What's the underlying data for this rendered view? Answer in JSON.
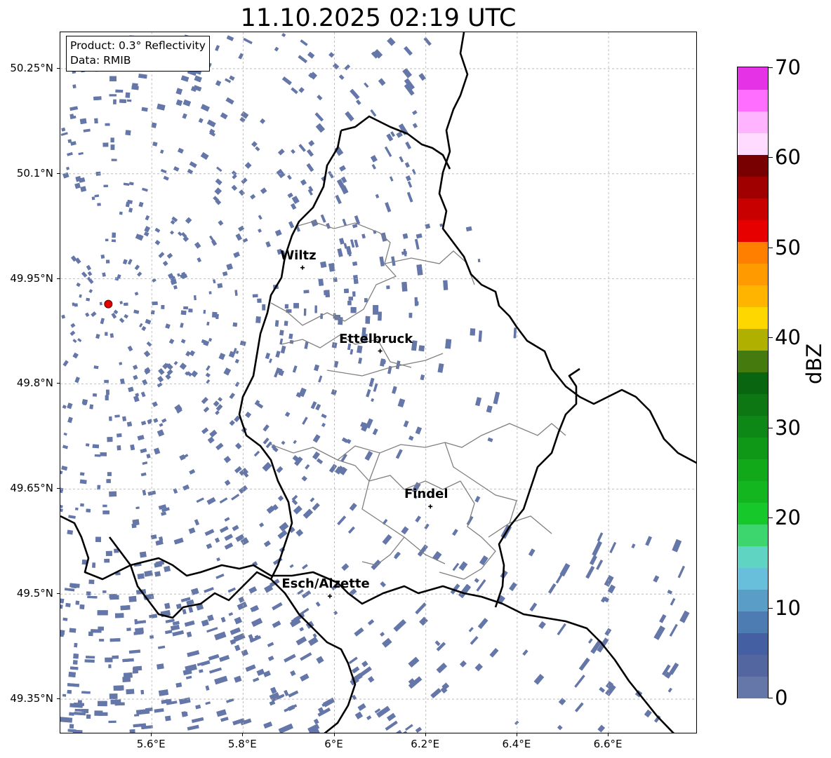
{
  "title": "11.10.2025 02:19 UTC",
  "info_box": {
    "product": "Product: 0.3° Reflectivity",
    "data_source": "Data: RMIB"
  },
  "y_ticks": [
    "50.25°N",
    "50.1°N",
    "49.95°N",
    "49.8°N",
    "49.65°N",
    "49.5°N",
    "49.35°N"
  ],
  "x_ticks": [
    "5.6°E",
    "5.8°E",
    "6°E",
    "6.2°E",
    "6.4°E",
    "6.6°E"
  ],
  "cities": [
    {
      "name": "Wiltz",
      "lon": 5.93,
      "lat": 49.966
    },
    {
      "name": "Ettelbruck",
      "lon": 6.1,
      "lat": 49.847
    },
    {
      "name": "Findel",
      "lon": 6.21,
      "lat": 49.625
    },
    {
      "name": "Esch/Alzette",
      "lon": 5.99,
      "lat": 49.497
    }
  ],
  "radar_site": {
    "lon": 5.505,
    "lat": 49.914,
    "color": "#e00000"
  },
  "map_extent": {
    "lon_min": 5.4,
    "lon_max": 6.795,
    "lat_min": 49.3,
    "lat_max": 50.302
  },
  "colorbar": {
    "label": "dBZ",
    "ticks": [
      "0",
      "10",
      "20",
      "30",
      "40",
      "50",
      "60",
      "70"
    ],
    "min": 0,
    "max": 70,
    "step": 2.5,
    "colors": [
      "#6577a8",
      "#5466a0",
      "#4460a3",
      "#4d7cb3",
      "#5a9ec7",
      "#67bfdb",
      "#5fd4c2",
      "#3dd66e",
      "#17c82a",
      "#13b61f",
      "#11a81a",
      "#0f9818",
      "#0d8716",
      "#0c7713",
      "#0a6510",
      "#457a0e",
      "#b0b000",
      "#ffd700",
      "#ffb400",
      "#ff9a00",
      "#ff8000",
      "#e60000",
      "#c80000",
      "#a00000",
      "#780000",
      "#ffdcff",
      "#ffb4ff",
      "#ff6eff",
      "#e632e6"
    ]
  },
  "echo_color": "#6577a8"
}
